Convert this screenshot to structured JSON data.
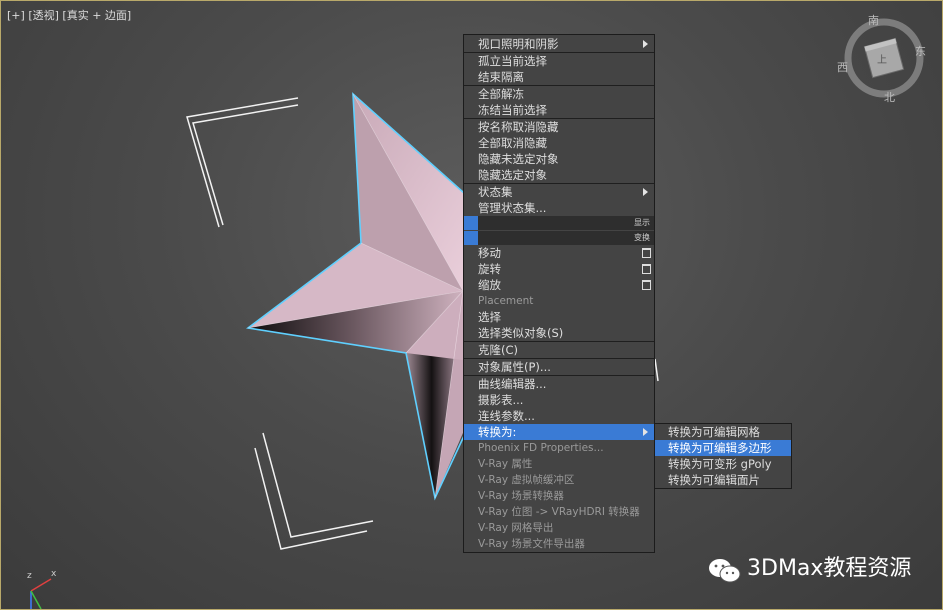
{
  "viewport": {
    "label_plus": "[+]",
    "label_view": "[透视]",
    "label_shading": "[真实 + 边面]"
  },
  "viewcube": {
    "north": "北",
    "south": "南",
    "east": "东",
    "west": "西",
    "center": "上"
  },
  "quad_menu": {
    "items": [
      "视口照明和阴影",
      "孤立当前选择",
      "结束隔离",
      "全部解冻",
      "冻结当前选择",
      "按名称取消隐藏",
      "全部取消隐藏",
      "隐藏未选定对象",
      "隐藏选定对象",
      "状态集",
      "管理状态集...",
      "移动",
      "旋转",
      "缩放",
      "Placement",
      "选择",
      "选择类似对象(S)",
      "克隆(C)",
      "对象属性(P)...",
      "曲线编辑器...",
      "摄影表...",
      "连线参数...",
      "转换为:",
      "Phoenix FD Properties...",
      "V-Ray 属性",
      "V-Ray 虚拟帧缓冲区",
      "V-Ray 场景转换器",
      "V-Ray 位图 -> VRayHDRI 转换器",
      "V-Ray 网格导出",
      "V-Ray 场景文件导出器"
    ],
    "quad_display": "显示",
    "quad_transform": "变换"
  },
  "convert_submenu": {
    "items": [
      "转换为可编辑网格",
      "转换为可编辑多边形",
      "转换为可变形 gPoly",
      "转换为可编辑面片"
    ]
  },
  "watermark": {
    "text": "3DMax教程资源"
  },
  "axis": {
    "z": "z",
    "x": "x"
  },
  "colors": {
    "menu_bg": "#444444",
    "highlight": "#3a7bd5",
    "star_fill": "#d9b9c6",
    "selection_outline": "#5fd0ff"
  }
}
